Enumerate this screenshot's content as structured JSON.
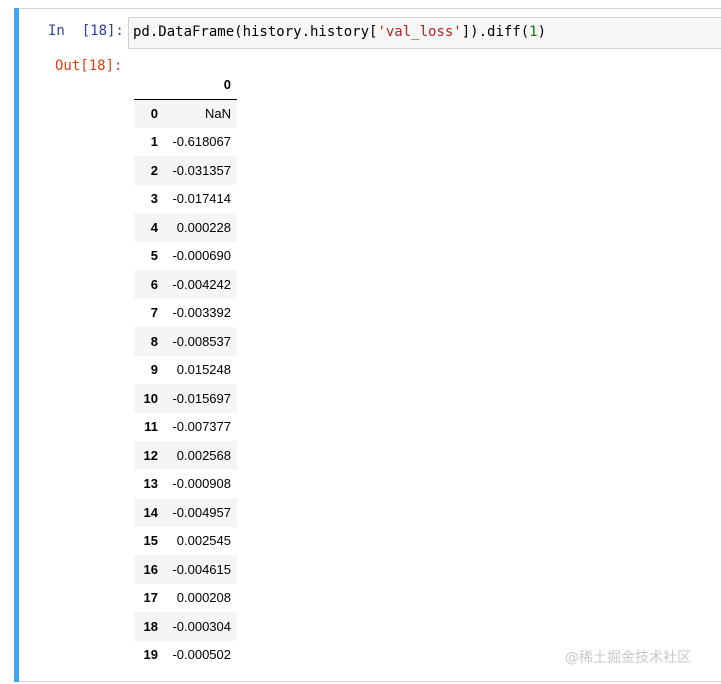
{
  "cell": {
    "in_prompt": "In  [18]:",
    "out_prompt": "Out[18]:",
    "code": {
      "part1": "pd.DataFrame(history.history[",
      "string": "'val_loss'",
      "part2": "]).diff(",
      "number": "1",
      "part3": ")"
    }
  },
  "output": {
    "column_header": "0",
    "rows": [
      {
        "index": "0",
        "value": "NaN"
      },
      {
        "index": "1",
        "value": "-0.618067"
      },
      {
        "index": "2",
        "value": "-0.031357"
      },
      {
        "index": "3",
        "value": "-0.017414"
      },
      {
        "index": "4",
        "value": "0.000228"
      },
      {
        "index": "5",
        "value": "-0.000690"
      },
      {
        "index": "6",
        "value": "-0.004242"
      },
      {
        "index": "7",
        "value": "-0.003392"
      },
      {
        "index": "8",
        "value": "-0.008537"
      },
      {
        "index": "9",
        "value": "0.015248"
      },
      {
        "index": "10",
        "value": "-0.015697"
      },
      {
        "index": "11",
        "value": "-0.007377"
      },
      {
        "index": "12",
        "value": "0.002568"
      },
      {
        "index": "13",
        "value": "-0.000908"
      },
      {
        "index": "14",
        "value": "-0.004957"
      },
      {
        "index": "15",
        "value": "0.002545"
      },
      {
        "index": "16",
        "value": "-0.004615"
      },
      {
        "index": "17",
        "value": "0.000208"
      },
      {
        "index": "18",
        "value": "-0.000304"
      },
      {
        "index": "19",
        "value": "-0.000502"
      }
    ]
  },
  "watermark": "@稀土掘金技术社区",
  "colors": {
    "cell_bar": "#42a5f5",
    "in_prompt": "#303f9f",
    "out_prompt": "#d84315",
    "string": "#ba2121",
    "number": "#008000"
  }
}
